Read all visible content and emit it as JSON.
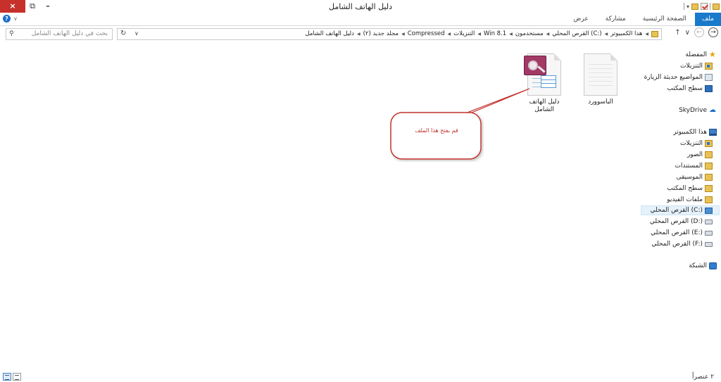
{
  "window": {
    "title": "دليل الهاتف الشامل",
    "close_label": "×",
    "restore_label": "⧉",
    "minimize_label": "–"
  },
  "ribbon": {
    "tabs": [
      {
        "label": "ملف",
        "active": true
      },
      {
        "label": "الصفحة الرئيسية"
      },
      {
        "label": "مشاركة"
      },
      {
        "label": "عرض"
      }
    ],
    "help_label": "?",
    "accent": "#1979ca"
  },
  "address_bar": {
    "breadcrumbs": [
      "هذا الكمبيوتر",
      "القرص المحلي (C:)",
      "مستخدمون",
      "Win 8.1",
      "التنزيلات",
      "Compressed",
      "مجلد جديد (٢)",
      "دليل الهاتف الشامل"
    ],
    "search_placeholder": "بحث في دليل الهاتف الشامل"
  },
  "nav_pane": {
    "favorites": {
      "label": "المفضلة",
      "items": [
        "التنزيلات",
        "المواضيع حديثة الزيارة",
        "سطح المكتب"
      ]
    },
    "skydrive": {
      "label": "SkyDrive"
    },
    "this_pc": {
      "label": "هذا الكمبيوتر",
      "items": [
        "التنزيلات",
        "الصور",
        "المستندات",
        "الموسيقى",
        "سطح المكتب",
        "ملفات الفيديو"
      ]
    },
    "drives": [
      "القرص المحلي (C:)",
      "القرص المحلي (D:)",
      "القرص المحلي (E:)",
      "القرص المحلي (F:)"
    ],
    "selected_drive": "القرص المحلي (C:)",
    "network": {
      "label": "الشبكة"
    }
  },
  "content": {
    "items": [
      {
        "name": "الباسوورد",
        "icon": "blank-document-icon"
      },
      {
        "name": "دليل الهاتف الشامل",
        "icon": "access-database-icon"
      }
    ]
  },
  "callout": {
    "text": "قم بفتح هذا الملف",
    "color": "#c4302b"
  },
  "status_bar": {
    "item_count": "٢ عنصراً"
  }
}
